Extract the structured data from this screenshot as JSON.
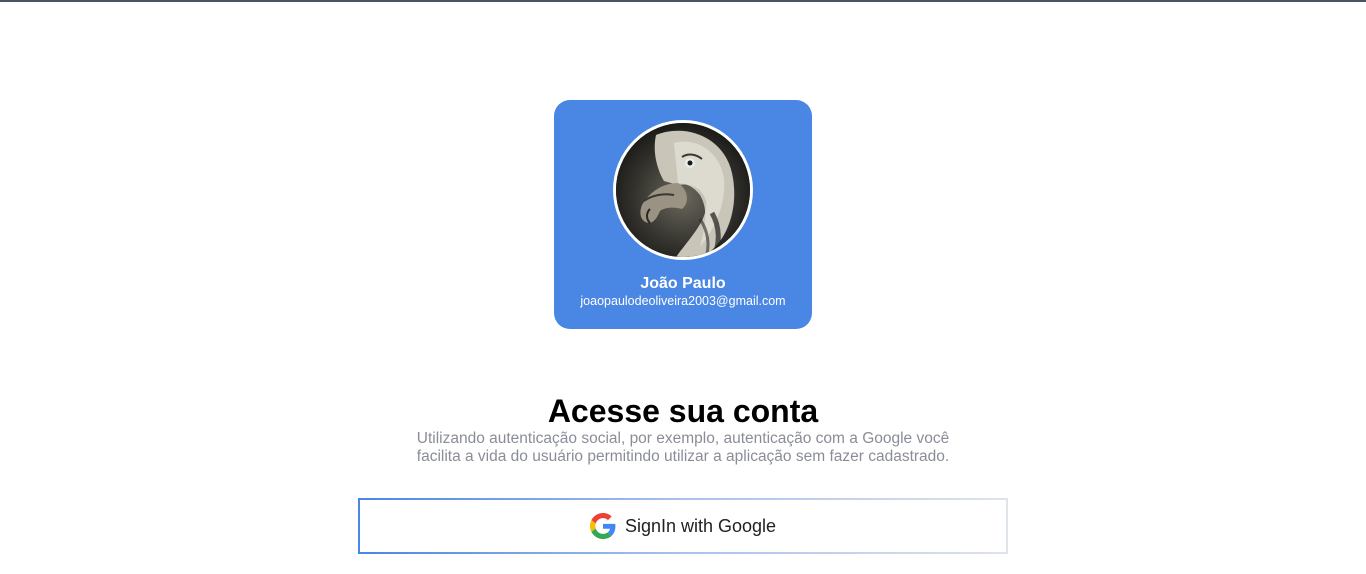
{
  "profile": {
    "name": "João Paulo",
    "email": "joaopaulodeoliveira2003@gmail.com",
    "card_color": "#4a86e4"
  },
  "heading": {
    "title": "Acesse sua conta",
    "subtitle": "Utilizando autenticação social, por exemplo, autenticação com a Google você facilita a vida do usuário permitindo utilizar a aplicação sem fazer cadastrado."
  },
  "signin": {
    "label": "SignIn with Google",
    "icon": "google-icon"
  }
}
